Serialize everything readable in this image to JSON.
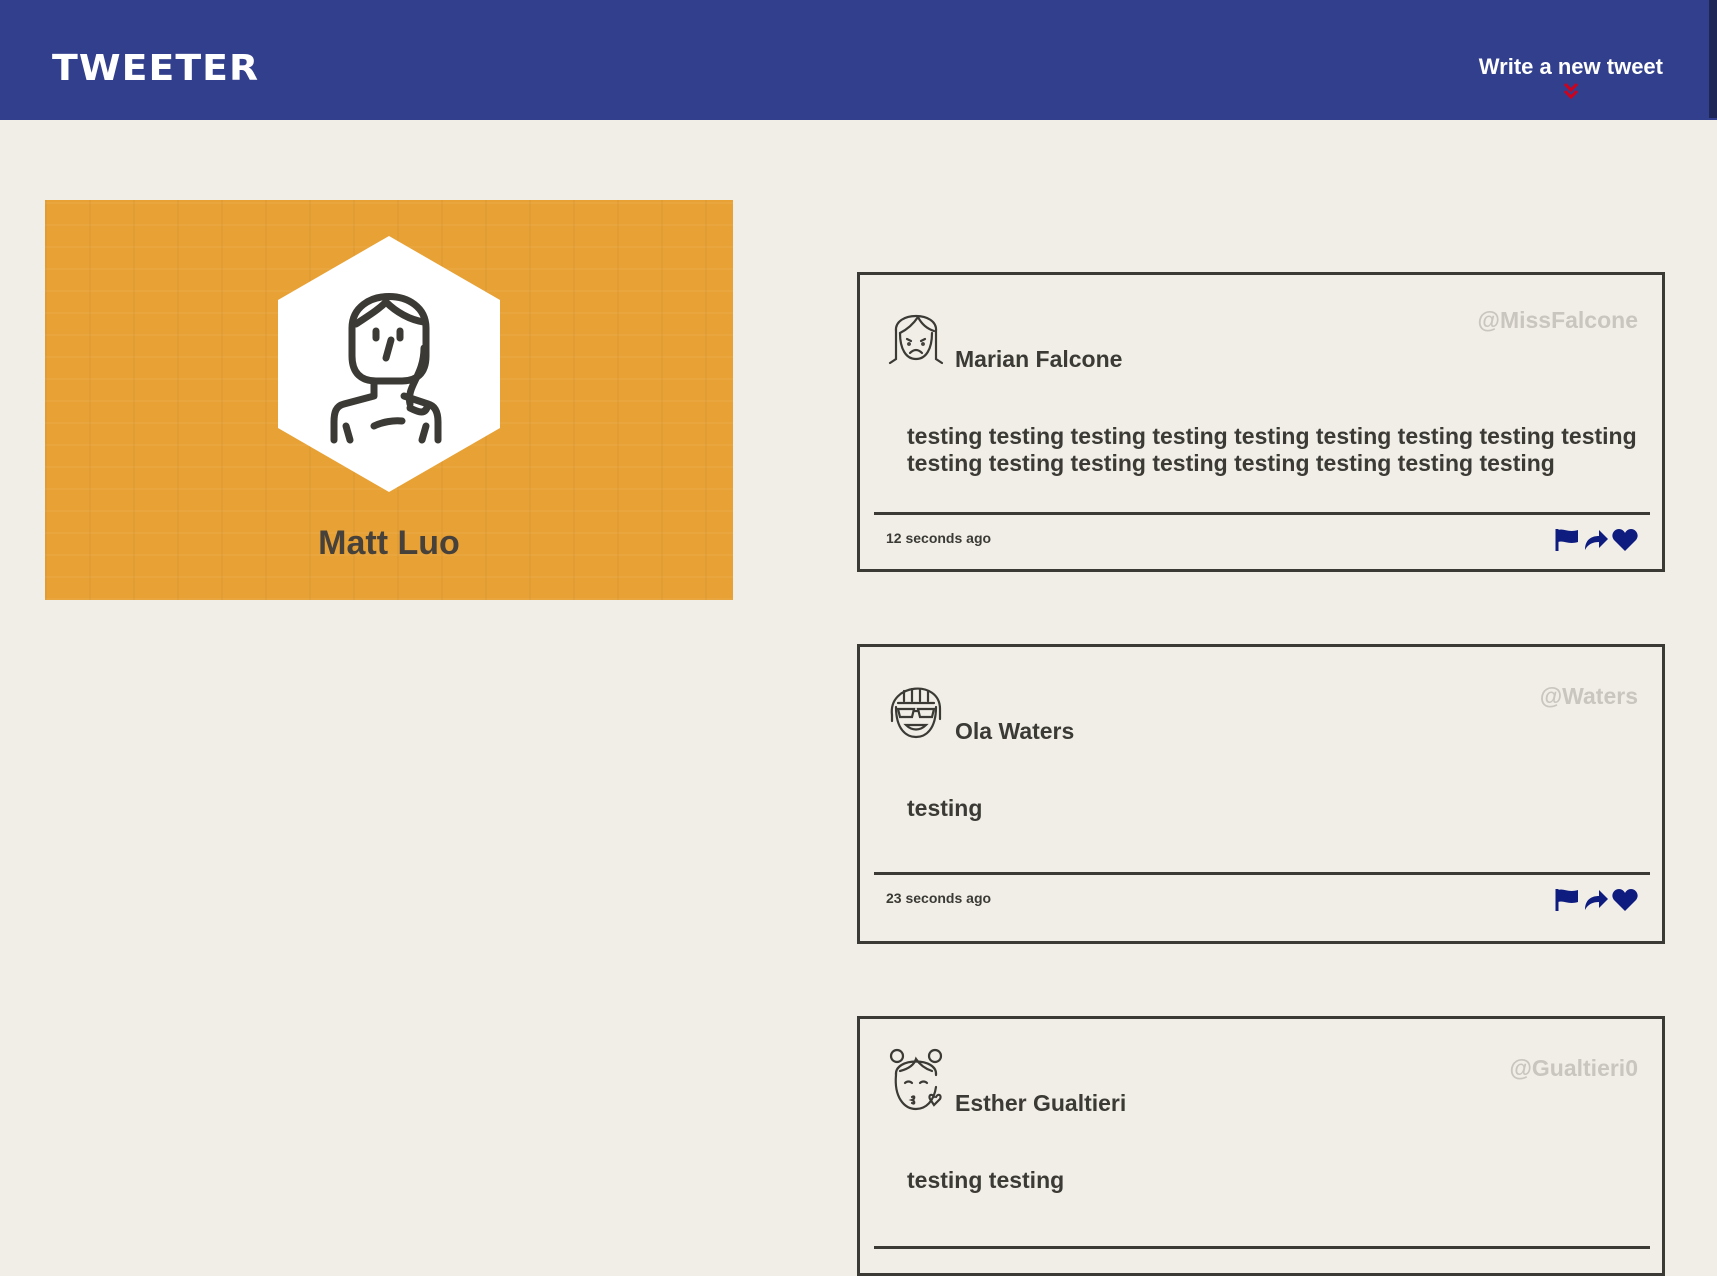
{
  "nav": {
    "brand": "TWEETER",
    "compose_label": "Write a new tweet",
    "compose_icon": "double-chevron-down-icon",
    "compose_icon_color": "#d0021b",
    "background_color": "#323f8d"
  },
  "profile": {
    "name": "Matt Luo",
    "avatar_icon": "woman-avatar-icon",
    "background_color": "#e8a135"
  },
  "tweets": [
    {
      "name": "Marian Falcone",
      "handle": "@MissFalcone",
      "avatar_icon": "sad-woman-avatar-icon",
      "body": "testing testing testing testing testing testing testing testing testing testing testing testing testing testing testing testing testing",
      "time": "12 seconds ago"
    },
    {
      "name": "Ola Waters",
      "handle": "@Waters",
      "avatar_icon": "sunglasses-woman-avatar-icon",
      "body": "testing",
      "time": "23 seconds ago"
    },
    {
      "name": "Esther Gualtieri",
      "handle": "@Gualtieri0",
      "avatar_icon": "kissing-girl-avatar-icon",
      "body": "testing testing",
      "time": ""
    }
  ],
  "tweet_actions": [
    "flag-icon",
    "retweet-icon",
    "heart-icon"
  ],
  "action_color": "#0e1c80"
}
